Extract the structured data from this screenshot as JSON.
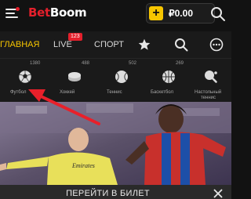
{
  "header": {
    "logo_part1": "Bet",
    "logo_part2": "Boom",
    "balance": "₽0.00",
    "add_funds_symbol": "+"
  },
  "nav": {
    "tabs": [
      {
        "label": "ГЛАВНАЯ",
        "active": true
      },
      {
        "label": "LIVE",
        "badge": "123"
      },
      {
        "label": "СПОРТ"
      }
    ]
  },
  "sports": [
    {
      "label": "Футбол",
      "count": "1380",
      "icon": "soccer-ball-icon"
    },
    {
      "label": "Хоккей",
      "count": "488",
      "icon": "hockey-puck-icon"
    },
    {
      "label": "Теннис",
      "count": "502",
      "icon": "tennis-ball-icon"
    },
    {
      "label": "Баскетбол",
      "count": "269",
      "icon": "basketball-icon"
    },
    {
      "label": "Настольный",
      "label2": "теннис",
      "count": "",
      "icon": "table-tennis-icon"
    }
  ],
  "banner": {
    "shirt_sponsor": "Emirates"
  },
  "bottom_bar": {
    "title": "ПЕРЕЙТИ В БИЛЕТ"
  },
  "colors": {
    "accent_yellow": "#f7c600",
    "brand_red": "#e4202c",
    "background": "#121212",
    "annotation_arrow": "#e8202a"
  }
}
